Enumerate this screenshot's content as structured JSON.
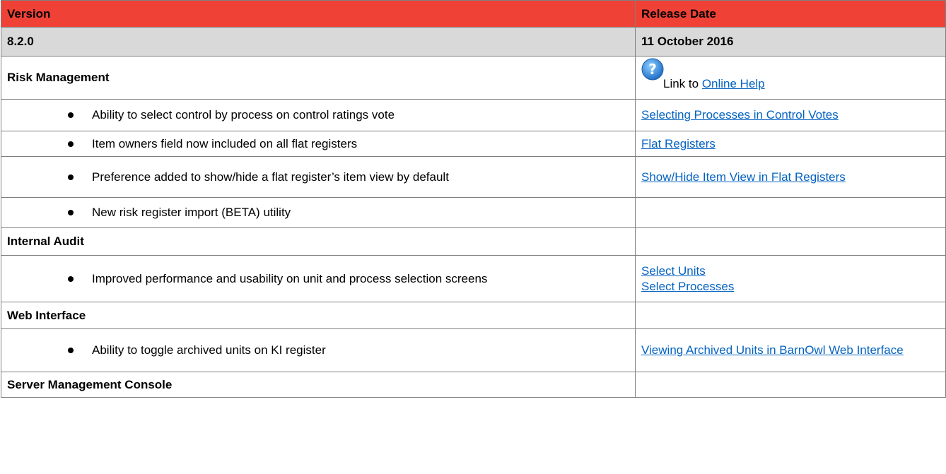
{
  "header": {
    "version_label": "Version",
    "release_date_label": "Release Date",
    "background_color": "#ef4136"
  },
  "release": {
    "version": "8.2.0",
    "date": "11 October 2016"
  },
  "help": {
    "icon": "question-help-icon",
    "prefix": "Link to ",
    "link_text": "Online Help",
    "link_color": "#0563c1"
  },
  "sections": [
    {
      "title": "Risk Management",
      "items": [
        {
          "text": "Ability to select control by process on control ratings vote",
          "links": [
            "Selecting Processes in Control Votes"
          ]
        },
        {
          "text": "Item owners field now included on all flat registers",
          "links": [
            "Flat Registers"
          ]
        },
        {
          "text": "Preference added to show/hide a flat register’s item view by default",
          "links": [
            "Show/Hide Item View in Flat Registers"
          ]
        },
        {
          "text": "New risk register import (BETA) utility",
          "links": []
        }
      ]
    },
    {
      "title": "Internal Audit",
      "items": [
        {
          "text": "Improved performance and usability on unit and process selection screens",
          "links": [
            "Select Units",
            "Select Processes"
          ]
        }
      ]
    },
    {
      "title": "Web Interface",
      "items": [
        {
          "text": "Ability to toggle archived units on KI register",
          "links": [
            "Viewing Archived Units in BarnOwl Web Interface"
          ]
        }
      ]
    },
    {
      "title": "Server Management Console",
      "items": []
    }
  ]
}
